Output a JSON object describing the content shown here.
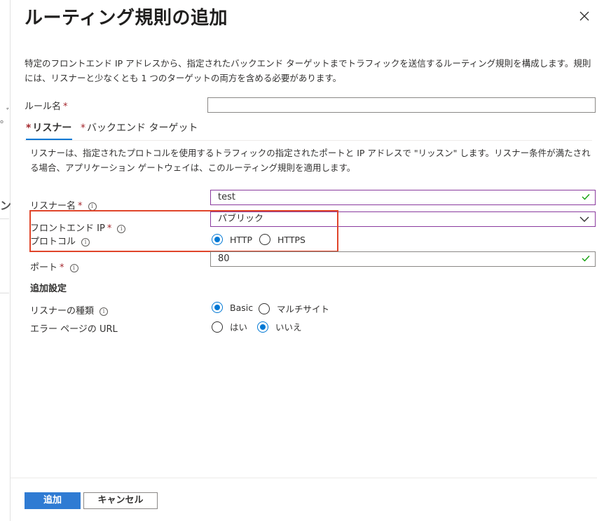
{
  "background": {
    "fragment1": "。",
    "fragment2": "ﾞ",
    "fragment3": "ン"
  },
  "panel": {
    "title": "ルーティング規則の追加",
    "description": "特定のフロントエンド IP アドレスから、指定されたバックエンド ターゲットまでトラフィックを送信するルーティング規則を構成します。規則には、リスナーと少なくとも 1 つのターゲットの両方を含める必要があります。",
    "rule_name": {
      "label": "ルール名",
      "value": ""
    },
    "tabs": [
      {
        "label": "リスナー",
        "active": true
      },
      {
        "label": "バックエンド ターゲット",
        "active": false
      }
    ],
    "listener_description": "リスナーは、指定されたプロトコルを使用するトラフィックの指定されたポートと IP アドレスで \"リッスン\" します。リスナー条件が満たされる場合、アプリケーション ゲートウェイは、このルーティング規則を適用します。",
    "listener_name": {
      "label": "リスナー名",
      "value": "test"
    },
    "frontend_ip": {
      "label": "フロントエンド IP",
      "value": "パブリック"
    },
    "protocol": {
      "label": "プロトコル",
      "options": [
        "HTTP",
        "HTTPS"
      ],
      "selected": "HTTP"
    },
    "port": {
      "label": "ポート",
      "value": "80"
    },
    "additional_settings": "追加設定",
    "listener_type": {
      "label": "リスナーの種類",
      "options": [
        "Basic",
        "マルチサイト"
      ],
      "selected": "Basic"
    },
    "error_page": {
      "label": "エラー ページの URL",
      "options": [
        "はい",
        "いいえ"
      ],
      "selected": "いいえ"
    },
    "footer": {
      "add_label": "追加",
      "cancel_label": "キャンセル"
    }
  },
  "colors": {
    "accent": "#0078d4",
    "required": "#a4262c",
    "highlight": "#e0452a",
    "valid": "#13a10e"
  }
}
